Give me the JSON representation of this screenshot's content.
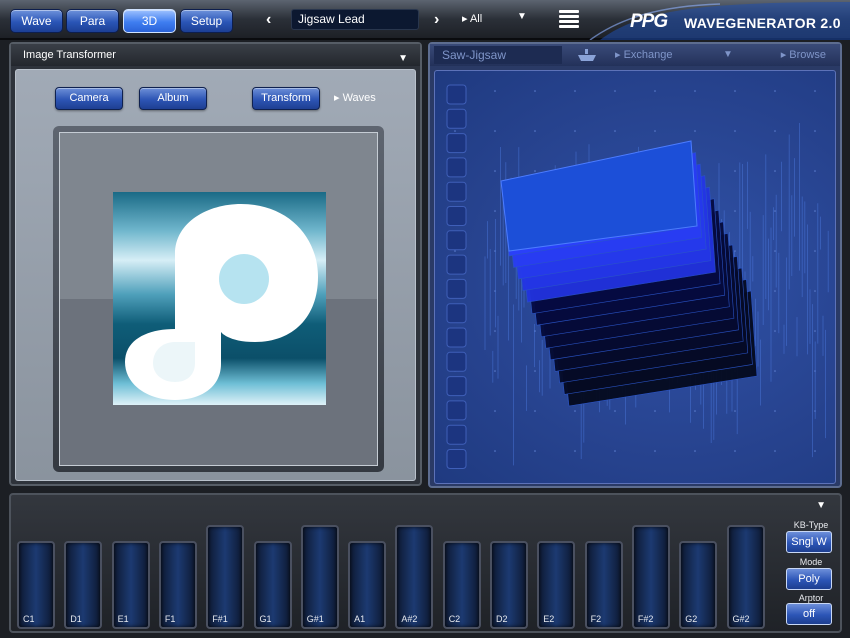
{
  "topbar": {
    "tabs": [
      {
        "label": "Wave",
        "active": false
      },
      {
        "label": "Para",
        "active": false
      },
      {
        "label": "3D",
        "active": true
      },
      {
        "label": "Setup",
        "active": false
      }
    ],
    "preset_name": "Jigsaw Lead",
    "filter_label": "▸ All",
    "logo_mark": "PPG",
    "app_title": "WAVEGENERATOR 2.0"
  },
  "left_panel": {
    "title": "Image Transformer",
    "buttons": {
      "camera": "Camera",
      "album": "Album",
      "transform": "Transform"
    },
    "waves_link": "▸ Waves"
  },
  "right_panel": {
    "wave_name": "Saw-Jigsaw",
    "exchange_link": "▸ Exchange",
    "browse_link": "▸ Browse"
  },
  "keyboard": {
    "keys": [
      {
        "note": "C1",
        "black": false
      },
      {
        "note": "D1",
        "black": false
      },
      {
        "note": "E1",
        "black": false
      },
      {
        "note": "F1",
        "black": false
      },
      {
        "note": "F#1",
        "black": true
      },
      {
        "note": "G1",
        "black": false
      },
      {
        "note": "G#1",
        "black": true
      },
      {
        "note": "A1",
        "black": false
      },
      {
        "note": "A#2",
        "black": true
      },
      {
        "note": "C2",
        "black": false
      },
      {
        "note": "D2",
        "black": false
      },
      {
        "note": "E2",
        "black": false
      },
      {
        "note": "F2",
        "black": false
      },
      {
        "note": "F#2",
        "black": true
      },
      {
        "note": "G2",
        "black": false
      },
      {
        "note": "G#2",
        "black": true
      }
    ],
    "controls": {
      "kb_type_label": "KB-Type",
      "kb_type_value": "Sngl W",
      "mode_label": "Mode",
      "mode_value": "Poly",
      "arptor_label": "Arptor",
      "arptor_value": "off"
    }
  },
  "colors": {
    "accent": "#2d55b5",
    "active_tab": "#3f7ef0",
    "wave_bg": "#27438f"
  }
}
